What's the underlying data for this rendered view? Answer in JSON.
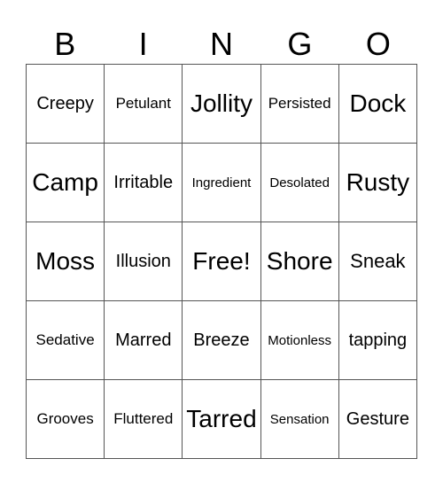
{
  "header": [
    "B",
    "I",
    "N",
    "G",
    "O"
  ],
  "rows": [
    [
      "Creepy",
      "Petulant",
      "Jollity",
      "Persisted",
      "Dock"
    ],
    [
      "Camp",
      "Irritable",
      "Ingredient",
      "Desolated",
      "Rusty"
    ],
    [
      "Moss",
      "Illusion",
      "Free!",
      "Shore",
      "Sneak"
    ],
    [
      "Sedative",
      "Marred",
      "Breeze",
      "Motionless",
      "tapping"
    ],
    [
      "Grooves",
      "Fluttered",
      "Tarred",
      "Sensation",
      "Gesture"
    ]
  ]
}
